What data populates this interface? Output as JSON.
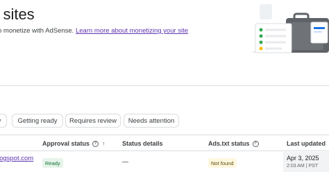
{
  "header": {
    "title": "r sites",
    "subtitle_prefix": "o monetize with AdSense.",
    "learn_more_link": "Learn more about monetizing your site"
  },
  "filters": [
    {
      "label": "y"
    },
    {
      "label": "Getting ready"
    },
    {
      "label": "Requires review"
    },
    {
      "label": "Needs attention"
    }
  ],
  "table": {
    "columns": {
      "approval_status": "Approval status",
      "status_details": "Status details",
      "ads_txt_status": "Ads.txt status",
      "last_updated": "Last updated"
    },
    "rows": [
      {
        "site": "logspot.com",
        "approval_status": "Ready",
        "status_details": "—",
        "ads_txt_status": "Not found",
        "last_updated_date": "Apr 3, 2025",
        "last_updated_time": "2:03 AM | PST"
      }
    ]
  },
  "colors": {
    "link": "#5e35b1",
    "ready_bg": "#e6f4ea",
    "ready_text": "#137333",
    "notfound_bg": "#fef7e0",
    "divider": "#dadce0"
  },
  "icons": {
    "help": "help-circle-icon",
    "sort": "arrow-up-icon",
    "illustration": "briefcase-checklist-illustration"
  }
}
